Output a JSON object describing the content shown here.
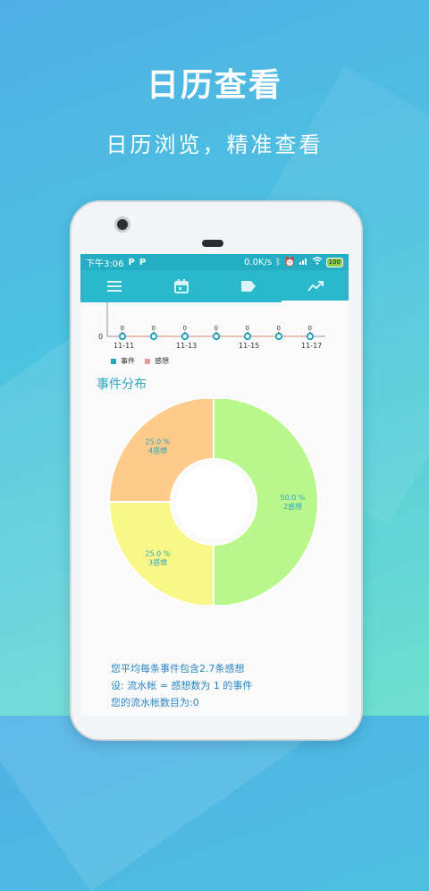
{
  "promo": {
    "title": "日历查看",
    "subtitle": "日历浏览，精准查看"
  },
  "statusbar": {
    "time": "下午3:06",
    "app_badges": [
      "P",
      "P"
    ],
    "net_speed": "0.0K/s",
    "battery": "100"
  },
  "tabs": [
    {
      "icon": "list-icon"
    },
    {
      "icon": "calendar-icon"
    },
    {
      "icon": "tag-icon"
    },
    {
      "icon": "trend-chart-icon",
      "active": true
    }
  ],
  "line_chart": {
    "type": "line",
    "y_axis_zero": "0",
    "x_ticks": [
      "11-11",
      "11-13",
      "11-15",
      "11-17"
    ],
    "points": [
      {
        "label": "0",
        "value": 0
      },
      {
        "label": "0",
        "value": 0
      },
      {
        "label": "0",
        "value": 0
      },
      {
        "label": "0",
        "value": 0
      },
      {
        "label": "0",
        "value": 0
      },
      {
        "label": "0",
        "value": 0
      },
      {
        "label": "0",
        "value": 0
      }
    ],
    "legend": [
      {
        "name": "事件",
        "color": "#2aa6bf"
      },
      {
        "name": "感想",
        "color": "#e59a94"
      }
    ]
  },
  "section_title": "事件分布",
  "chart_data": {
    "type": "pie",
    "slices": [
      {
        "percent": "50.0 %",
        "count": "2感想",
        "value": 50,
        "color": "#b9f78c"
      },
      {
        "percent": "25.0 %",
        "count": "3感想",
        "value": 25,
        "color": "#f9f787"
      },
      {
        "percent": "25.0 %",
        "count": "4感想",
        "value": 25,
        "color": "#fdcb8a"
      }
    ]
  },
  "stats": {
    "line1": "您平均每条事件包含2.7条感想",
    "line2": "设: 流水帐 = 感想数为 1 的事件",
    "line3": "您的流水帐数目为:0"
  }
}
